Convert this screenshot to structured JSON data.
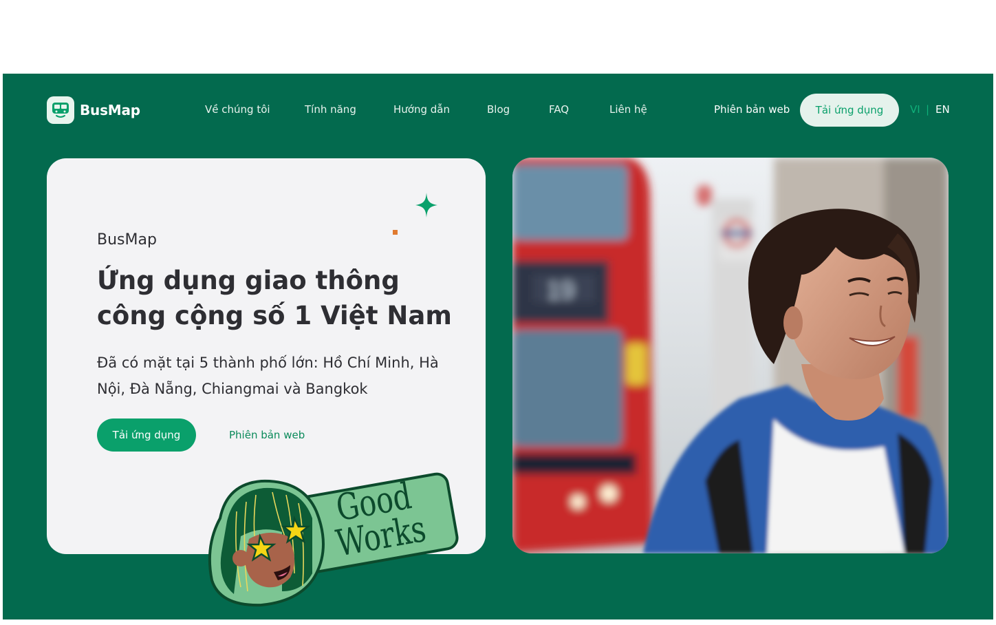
{
  "brand": {
    "name": "BusMap",
    "logo_icon": "bus-icon"
  },
  "nav": {
    "links": [
      "Về chúng tôi",
      "Tính năng",
      "Hướng dẫn",
      "Blog",
      "FAQ",
      "Liên hệ"
    ],
    "web_version": "Phiên bản web",
    "download": "Tải ứng dụng",
    "lang_vi": "VI",
    "lang_sep": "|",
    "lang_en": "EN"
  },
  "hero": {
    "eyebrow": "BusMap",
    "headline": "Ứng dụng giao thông công cộng số 1 Việt Nam",
    "subtext": "Đã có mặt tại 5 thành phố lớn: Hồ Chí Minh, Hà Nội, Đà Nẵng, Chiangmai và Bangkok",
    "cta_primary": "Tải ứng dụng",
    "cta_secondary": "Phiên bản web"
  },
  "sticker": {
    "line1": "Good",
    "line2": "Works"
  },
  "colors": {
    "background": "#036A4E",
    "card": "#F3F3F5",
    "accent": "#0AA06B",
    "text": "#2E2E33",
    "orange": "#E07A2F"
  }
}
